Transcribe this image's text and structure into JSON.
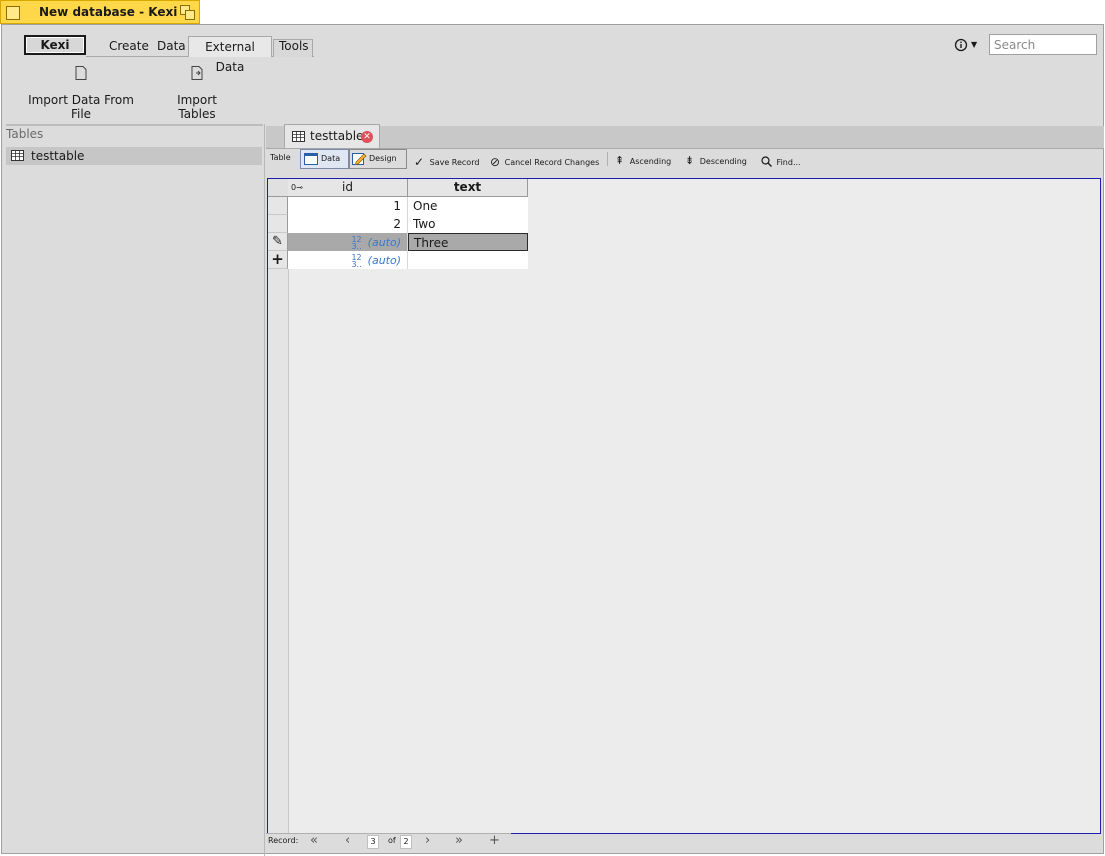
{
  "window": {
    "title": "New database - Kexi"
  },
  "ribbon": {
    "app_tab": "Kexi",
    "tabs": [
      {
        "label": "Create"
      },
      {
        "label": "Data"
      },
      {
        "label": "External Data"
      },
      {
        "label": "Tools"
      }
    ],
    "search_placeholder": "Search",
    "buttons": [
      {
        "label": "Import Data From File",
        "icon": "file-icon"
      },
      {
        "label": "Import Tables",
        "icon": "import-tables-icon"
      }
    ]
  },
  "project_navigator": {
    "header": "Tables",
    "items": [
      {
        "label": "testtable",
        "icon": "table-icon"
      }
    ]
  },
  "document": {
    "tab_label": "testtable",
    "toolbar": {
      "section_label": "Table",
      "data_view": "Data",
      "design_view": "Design",
      "save_record": "Save Record",
      "cancel_changes": "Cancel Record Changes",
      "ascending": "Ascending",
      "descending": "Descending",
      "find": "Find..."
    },
    "grid": {
      "columns": [
        "id",
        "text"
      ],
      "rows": [
        {
          "id": "1",
          "text": "One"
        },
        {
          "id": "2",
          "text": "Two"
        },
        {
          "id": "(auto)",
          "text": "Three"
        },
        {
          "id": "(auto)",
          "text": ""
        }
      ],
      "auto_glyph_top": "12",
      "auto_glyph_bottom": "3.."
    },
    "record_nav": {
      "label": "Record:",
      "current": "3",
      "of_label": "of",
      "total": "2"
    }
  },
  "colors": {
    "title_bar": "#ffd84a",
    "grid_border": "#1e1ea8",
    "auto_value": "#3a78c8",
    "close_badge": "#e0505a"
  }
}
